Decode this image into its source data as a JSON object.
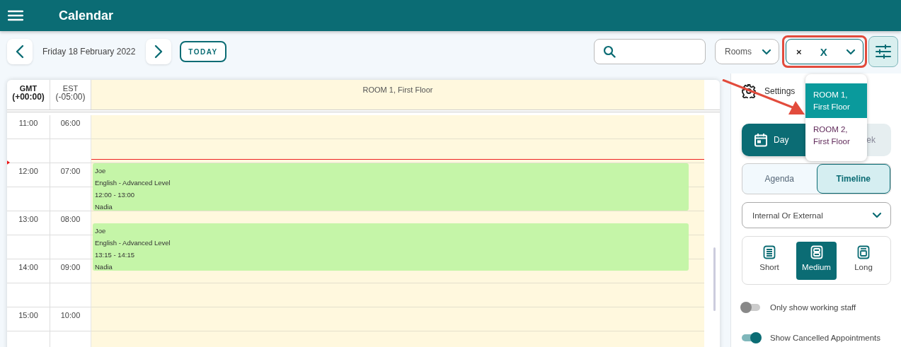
{
  "header": {
    "title": "Calendar"
  },
  "toolbar": {
    "date": "Friday 18 February 2022",
    "today_button": "TODAY",
    "resource_type": "Rooms",
    "room_selector": {
      "chip_remove": "×",
      "clear": "X"
    }
  },
  "room_menu": {
    "items": [
      {
        "label": "ROOM 1, First Floor",
        "selected": true
      },
      {
        "label": "ROOM 2, First Floor",
        "selected": false
      }
    ]
  },
  "calendar": {
    "timezones": [
      {
        "name": "GMT",
        "offset": "(+00:00)",
        "primary": true
      },
      {
        "name": "EST",
        "offset": "(-05:00)",
        "primary": false
      }
    ],
    "room": "ROOM 1, First Floor",
    "rows": [
      {
        "gmt": "11:00",
        "est": "06:00"
      },
      {
        "now": true
      },
      {
        "gmt": "12:00",
        "est": "07:00",
        "events": [
          {
            "kind": "on-hour",
            "lines": [
              "Joe",
              "English - Advanced Level",
              "12:00 - 13:00",
              "Nadia"
            ]
          }
        ]
      },
      {},
      {
        "gmt": "13:00",
        "est": "08:00",
        "events": [
          {
            "kind": "quarter-past",
            "lines": [
              "Joe",
              "English - Advanced Level",
              "13:15 - 14:15",
              "Nadia"
            ]
          }
        ]
      },
      {},
      {
        "gmt": "14:00",
        "est": "09:00"
      },
      {},
      {
        "gmt": "15:00",
        "est": "10:00"
      },
      {}
    ]
  },
  "settings": {
    "title": "Settings",
    "view_tabs": [
      {
        "label": "Day",
        "selected": true
      },
      {
        "label": "ek",
        "selected": false
      }
    ],
    "mode_tabs": [
      {
        "label": "Agenda",
        "selected": false
      },
      {
        "label": "Timeline",
        "selected": true
      }
    ],
    "filter": "Internal Or External",
    "sizes": [
      {
        "label": "Short",
        "selected": false
      },
      {
        "label": "Medium",
        "selected": true
      },
      {
        "label": "Long",
        "selected": false
      }
    ],
    "toggles": [
      {
        "label": "Only show working staff",
        "on": false
      },
      {
        "label": "Show Cancelled Appointments",
        "on": true
      }
    ]
  }
}
